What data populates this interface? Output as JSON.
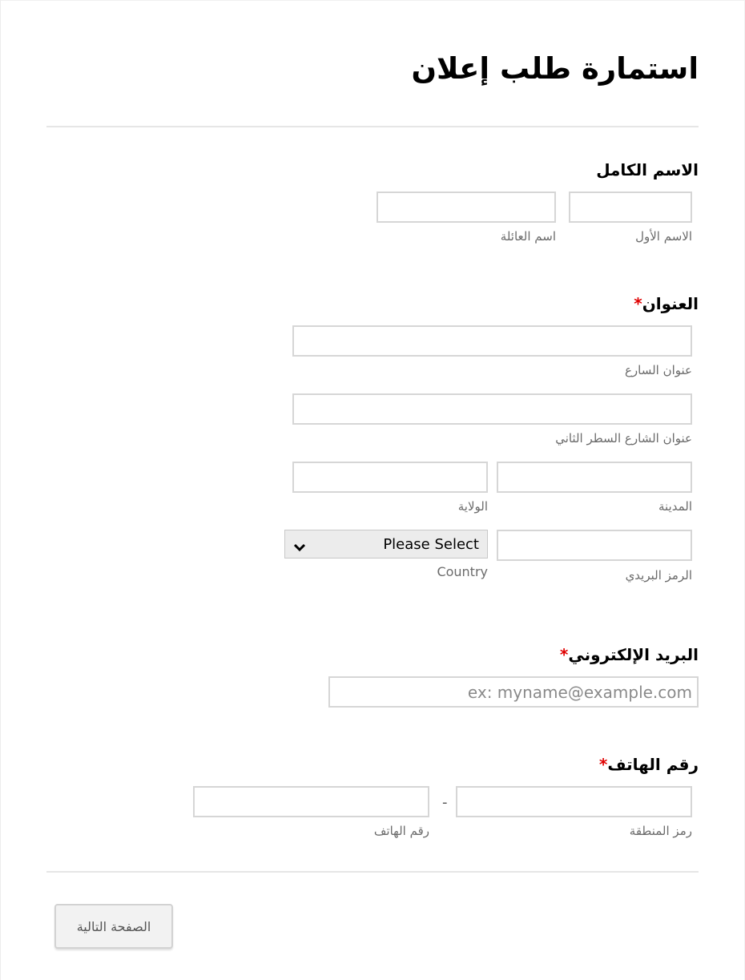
{
  "form": {
    "title": "استمارة طلب إعلان",
    "required_mark": "*",
    "colors": {
      "required": "#e00000",
      "sublabel": "#6b6b6b",
      "border": "#d6d6d6"
    },
    "full_name": {
      "label": "الاسم الكامل",
      "first_name": {
        "sublabel": "الاسم الأول",
        "value": ""
      },
      "last_name": {
        "sublabel": "اسم العائلة",
        "value": ""
      }
    },
    "address": {
      "label": "العنوان",
      "required": true,
      "street1": {
        "sublabel": "عنوان السارع",
        "value": ""
      },
      "street2": {
        "sublabel": "عنوان الشارع السطر الثاني",
        "value": ""
      },
      "city": {
        "sublabel": "المدينة",
        "value": ""
      },
      "state": {
        "sublabel": "الولاية",
        "value": ""
      },
      "postal": {
        "sublabel": "الرمز البريدي",
        "value": ""
      },
      "country": {
        "sublabel": "Country",
        "selected": "Please Select",
        "icon": "chevron-down-icon"
      }
    },
    "email": {
      "label": "البريد الإلكتروني",
      "required": true,
      "placeholder": "ex: myname@example.com",
      "value": ""
    },
    "phone": {
      "label": "رقم الهاتف",
      "required": true,
      "separator": "-",
      "area_code": {
        "sublabel": "رمز المنطقة",
        "value": ""
      },
      "number": {
        "sublabel": "رقم الهاتف",
        "value": ""
      }
    },
    "next_button": {
      "label": "الصفحة التالية"
    }
  }
}
